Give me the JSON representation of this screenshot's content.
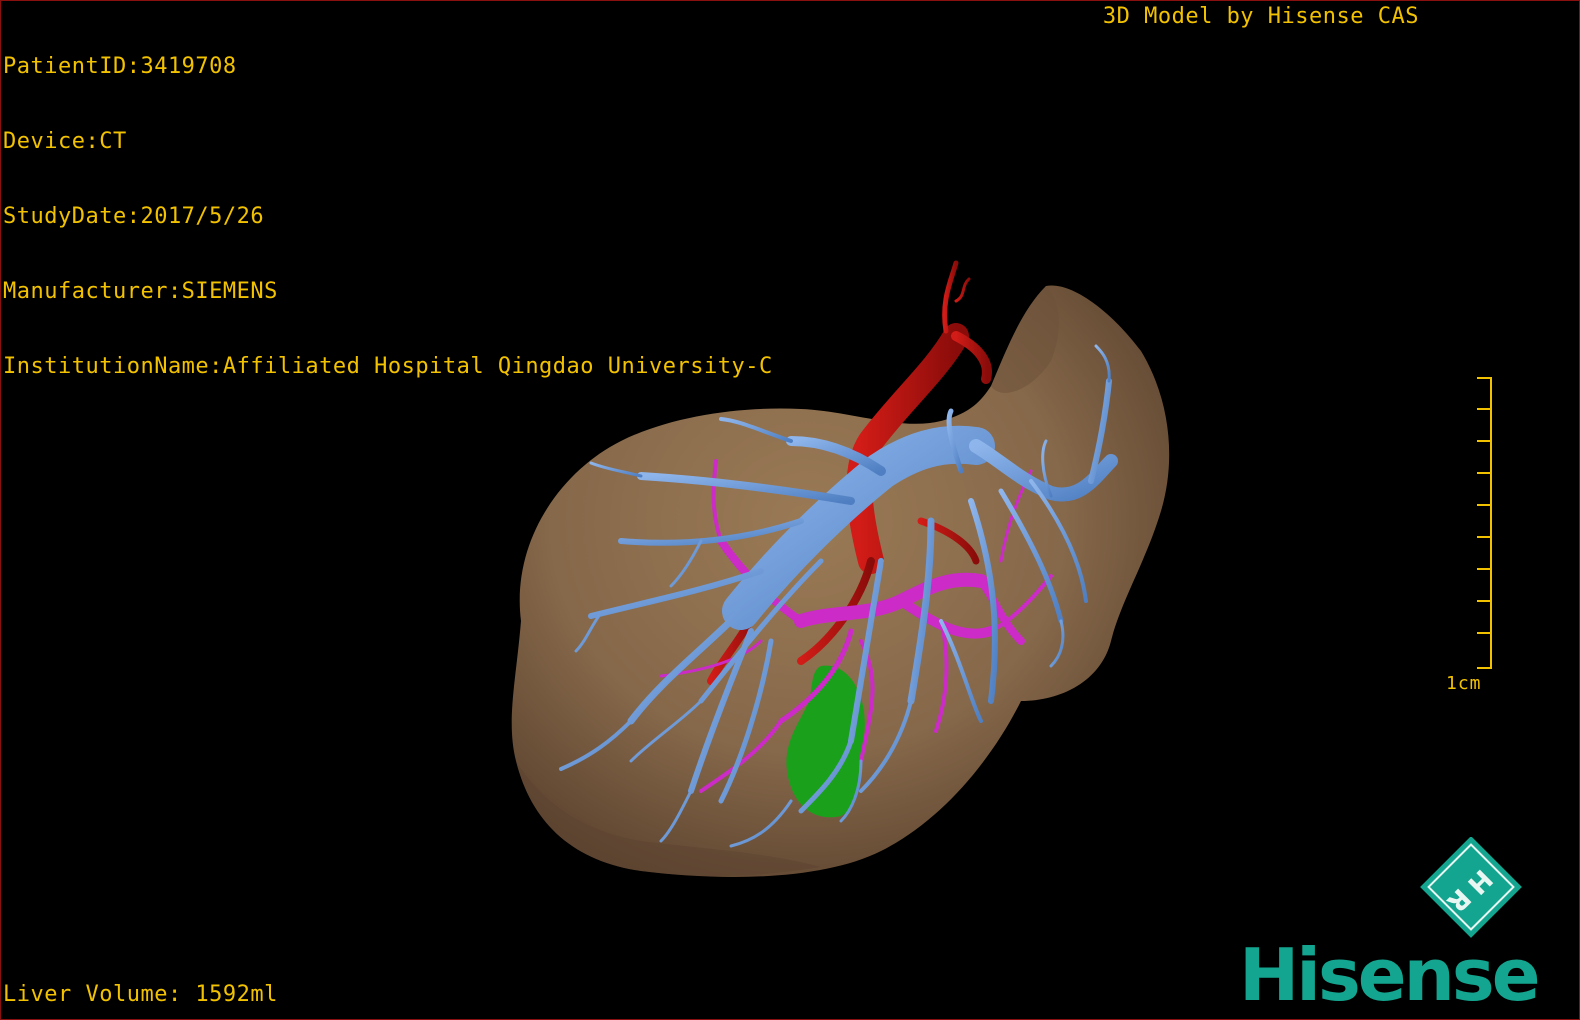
{
  "patient_info": {
    "patient_id": "PatientID:3419708",
    "device": "Device:CT",
    "study_date": "StudyDate:2017/5/26",
    "manufacturer": "Manufacturer:SIEMENS",
    "institution": "InstitutionName:Affiliated Hospital Qingdao University-C"
  },
  "watermark_title": "3D Model by Hisense CAS",
  "liver_volume": "Liver Volume: 1592ml",
  "scale_bar": {
    "label": "1cm"
  },
  "logo": {
    "brand": "Hisense",
    "badge_letters": "HR"
  },
  "colors": {
    "overlay_text": "#f2c200",
    "liver": "#8b6d4a",
    "hepatic_vein": "#6f9bd8",
    "portal_vein": "#cc2bc8",
    "artery": "#b3120f",
    "gallbladder": "#1a9a1a",
    "brand": "#13a58f"
  }
}
